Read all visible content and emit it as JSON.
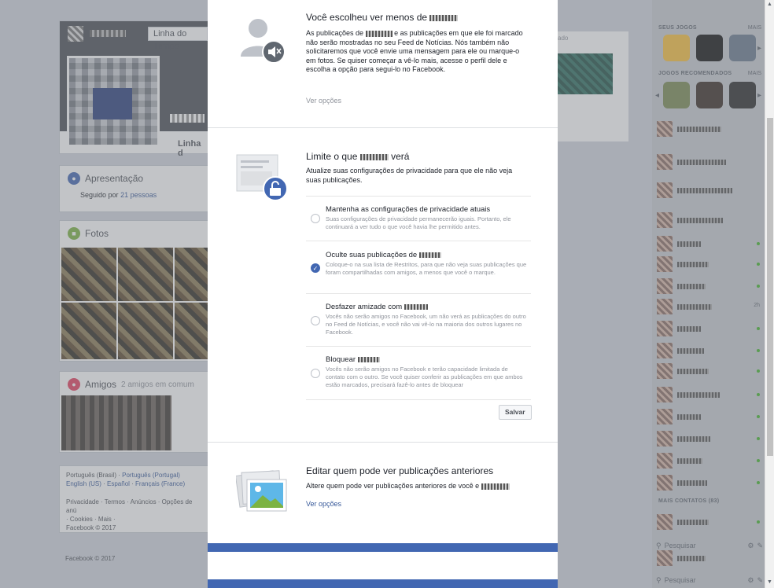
{
  "background": {
    "timeline_tab": "Linha do Tempo",
    "cover_tab": "Linha d",
    "intro_title": "Apresentação",
    "followed_by_prefix": "Seguido por",
    "followed_by_link": "21 pessoas",
    "photos_title": "Fotos",
    "friends_title": "Amigos",
    "friends_common": "2 amigos em comum",
    "languages": {
      "line1_a": "Português (Brasil)",
      "line1_b": "Português (Portugal)",
      "line2_a": "English (US)",
      "line2_b": "Español",
      "line2_c": "Français (France)"
    },
    "footer_links": "Privacidade · Termos · Anúncios · Opções de anú",
    "footer_links2": "· Cookies · Mais ·",
    "copyright1": "Facebook © 2017",
    "copyright2": "Facebook © 2017",
    "mid_text": "ado"
  },
  "sidebar": {
    "games_heading": "SEUS JOGOS",
    "games_more": "MAIS",
    "recommended_heading": "JOGOS RECOMENDADOS",
    "recommended_more": "MAIS",
    "more_contacts": "MAIS CONTATOS (83)",
    "search_placeholder": "Pesquisar",
    "contact_time": "2h"
  },
  "modal": {
    "section1": {
      "title_prefix": "Você escolheu ver menos de",
      "body_prefix": "As publicações de",
      "body_rest": "e as publicações em que ele foi marcado não serão mostradas no seu Feed de Notícias. Nós também não solicitaremos que você envie uma mensagem para ele ou marque-o em fotos. Se quiser começar a vê-lo mais, acesse o perfil dele e escolha a opção para segui-lo no Facebook.",
      "link": "Ver opções"
    },
    "section2": {
      "title_prefix": "Limite o que",
      "title_suffix": "verá",
      "body": "Atualize suas configurações de privacidade para que ele não veja suas publicações.",
      "options": [
        {
          "title": "Mantenha as configurações de privacidade atuais",
          "desc": "Suas configurações de privacidade permanecerão iguais. Portanto, ele continuará a ver tudo o que você havia lhe permitido antes.",
          "selected": false
        },
        {
          "title": "Oculte suas publicações de",
          "desc": "Coloque-o na sua lista de Restritos, para que não veja suas publicações que foram compartilhadas com amigos, a menos que você o marque.",
          "selected": true
        },
        {
          "title": "Desfazer amizade com",
          "desc": "Vocês não serão amigos no Facebook, um não verá as publicações do outro no Feed de Notícias, e você não vai vê-lo na maioria dos outros lugares no Facebook.",
          "selected": false
        },
        {
          "title": "Bloquear",
          "desc": "Vocês não serão amigos no Facebook e terão capacidade limitada de contato com o outro. Se você quiser conferir as publicações em que ambos estão marcados, precisará fazê-lo antes de bloquear",
          "selected": false
        }
      ],
      "save_label": "Salvar"
    },
    "section3": {
      "title": "Editar quem pode ver publicações anteriores",
      "body_prefix": "Altere quem pode ver publicações anteriores de você e",
      "link": "Ver opções"
    }
  },
  "colors": {
    "facebook_blue": "#4267b2",
    "link_blue": "#365899",
    "muted_grey": "#90949c",
    "online_green": "#42b72a"
  },
  "icons": {
    "section1": "muted-person-icon",
    "section2": "padlock-privacy-icon",
    "section3": "photo-stack-icon",
    "check": "check-icon"
  }
}
